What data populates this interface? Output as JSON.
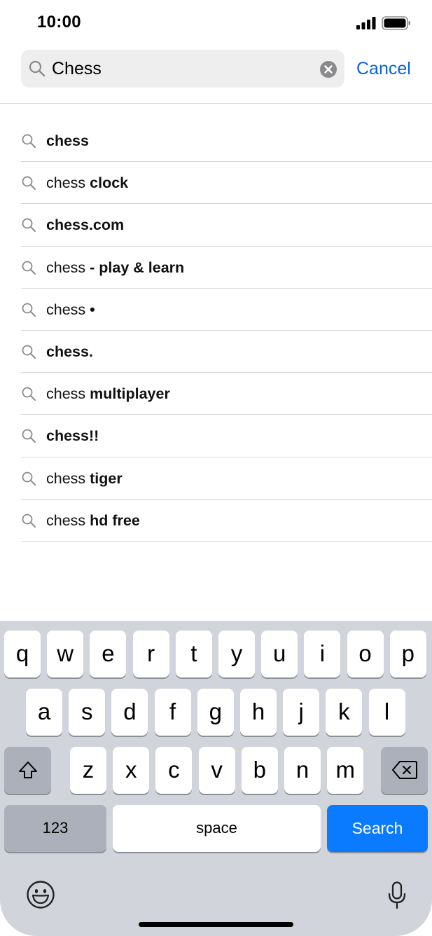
{
  "status_bar": {
    "time": "10:00",
    "signal_icon": "signal-bars-icon",
    "battery_icon": "battery-full-icon"
  },
  "search": {
    "value": "Chess",
    "placeholder": "",
    "clear_icon": "clear-circle-icon",
    "cancel_label": "Cancel"
  },
  "suggestions": [
    {
      "plain": "",
      "bold": "chess"
    },
    {
      "plain": "chess ",
      "bold": "clock"
    },
    {
      "plain": "",
      "bold": "chess.com"
    },
    {
      "plain": "chess ",
      "bold": "- play & learn"
    },
    {
      "plain": "chess ",
      "bold": "•"
    },
    {
      "plain": "",
      "bold": "chess."
    },
    {
      "plain": "chess ",
      "bold": "multiplayer"
    },
    {
      "plain": "",
      "bold": "chess!!"
    },
    {
      "plain": "chess ",
      "bold": "tiger"
    },
    {
      "plain": "chess ",
      "bold": "hd free"
    }
  ],
  "keyboard": {
    "row1": [
      "q",
      "w",
      "e",
      "r",
      "t",
      "y",
      "u",
      "i",
      "o",
      "p"
    ],
    "row2": [
      "a",
      "s",
      "d",
      "f",
      "g",
      "h",
      "j",
      "k",
      "l"
    ],
    "row3": [
      "z",
      "x",
      "c",
      "v",
      "b",
      "n",
      "m"
    ],
    "numbers_label": "123",
    "space_label": "space",
    "search_label": "Search",
    "shift_icon": "shift-icon",
    "delete_icon": "backspace-icon",
    "emoji_icon": "emoji-icon",
    "mic_icon": "microphone-icon"
  },
  "colors": {
    "accent": "#0a64d6",
    "search_key": "#0a7aff",
    "keyboard_bg": "#d1d4da"
  }
}
